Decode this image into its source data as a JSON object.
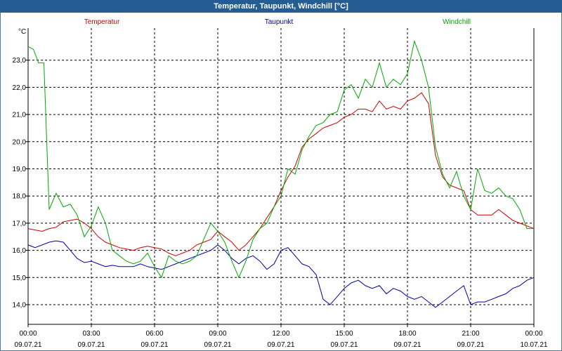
{
  "window": {
    "title": "Temperatur, Taupunkt, Windchill [°C]"
  },
  "chart_data": {
    "type": "line",
    "title": "Temperatur, Taupunkt, Windchill [°C]",
    "ylabel": "°C",
    "ylim": [
      13.4,
      24.0
    ],
    "yticks": [
      "14,0",
      "15,0",
      "16,0",
      "17,0",
      "18,0",
      "19,0",
      "20,0",
      "21,0",
      "22,0",
      "23,0"
    ],
    "ytick_values": [
      14,
      15,
      16,
      17,
      18,
      19,
      20,
      21,
      22,
      23
    ],
    "xlim": [
      0,
      24
    ],
    "xticks": [
      {
        "time": "00:00",
        "date": "09.07.21",
        "hour": 0
      },
      {
        "time": "03:00",
        "date": "09.07.21",
        "hour": 3
      },
      {
        "time": "06:00",
        "date": "09.07.21",
        "hour": 6
      },
      {
        "time": "09:00",
        "date": "09.07.21",
        "hour": 9
      },
      {
        "time": "12:00",
        "date": "09.07.21",
        "hour": 12
      },
      {
        "time": "15:00",
        "date": "09.07.21",
        "hour": 15
      },
      {
        "time": "18:00",
        "date": "09.07.21",
        "hour": 18
      },
      {
        "time": "21:00",
        "date": "09.07.21",
        "hour": 21
      },
      {
        "time": "00:00",
        "date": "10.07.21",
        "hour": 24
      }
    ],
    "grid": true,
    "legend_position": "top",
    "series": [
      {
        "name": "Temperatur",
        "color": "#cc0000",
        "points": [
          [
            0,
            16.8
          ],
          [
            0.33,
            16.75
          ],
          [
            0.67,
            16.7
          ],
          [
            1,
            16.8
          ],
          [
            1.33,
            16.85
          ],
          [
            1.67,
            17.05
          ],
          [
            2,
            17.1
          ],
          [
            2.33,
            17.15
          ],
          [
            2.67,
            17.0
          ],
          [
            3,
            16.8
          ],
          [
            3.33,
            16.5
          ],
          [
            3.67,
            16.3
          ],
          [
            4,
            16.2
          ],
          [
            4.33,
            16.1
          ],
          [
            4.67,
            16.05
          ],
          [
            5,
            16.0
          ],
          [
            5.33,
            16.1
          ],
          [
            5.67,
            16.15
          ],
          [
            6,
            16.1
          ],
          [
            6.33,
            16.05
          ],
          [
            6.67,
            15.9
          ],
          [
            7,
            15.8
          ],
          [
            7.33,
            15.9
          ],
          [
            7.67,
            16.0
          ],
          [
            8,
            16.2
          ],
          [
            8.33,
            16.3
          ],
          [
            8.67,
            16.4
          ],
          [
            9,
            16.7
          ],
          [
            9.33,
            16.5
          ],
          [
            9.67,
            16.3
          ],
          [
            10,
            16.0
          ],
          [
            10.33,
            16.2
          ],
          [
            10.67,
            16.5
          ],
          [
            11,
            16.8
          ],
          [
            11.33,
            17.2
          ],
          [
            11.67,
            17.6
          ],
          [
            12,
            18.2
          ],
          [
            12.33,
            18.7
          ],
          [
            12.67,
            19.1
          ],
          [
            13,
            19.8
          ],
          [
            13.33,
            20.1
          ],
          [
            13.67,
            20.3
          ],
          [
            14,
            20.5
          ],
          [
            14.33,
            20.6
          ],
          [
            14.67,
            20.7
          ],
          [
            15,
            20.9
          ],
          [
            15.33,
            21.0
          ],
          [
            15.67,
            21.2
          ],
          [
            16,
            21.2
          ],
          [
            16.33,
            21.1
          ],
          [
            16.67,
            21.5
          ],
          [
            17,
            21.2
          ],
          [
            17.33,
            21.3
          ],
          [
            17.67,
            21.2
          ],
          [
            18,
            21.5
          ],
          [
            18.33,
            21.6
          ],
          [
            18.67,
            21.8
          ],
          [
            19,
            21.4
          ],
          [
            19.33,
            19.5
          ],
          [
            19.67,
            18.7
          ],
          [
            20,
            18.4
          ],
          [
            20.33,
            18.3
          ],
          [
            20.67,
            18.2
          ],
          [
            21,
            17.5
          ],
          [
            21.33,
            17.3
          ],
          [
            21.67,
            17.3
          ],
          [
            22,
            17.3
          ],
          [
            22.33,
            17.5
          ],
          [
            22.67,
            17.3
          ],
          [
            23,
            17.1
          ],
          [
            23.33,
            17.0
          ],
          [
            23.67,
            16.9
          ],
          [
            24,
            16.8
          ]
        ]
      },
      {
        "name": "Taupunkt",
        "color": "#0000aa",
        "points": [
          [
            0,
            16.2
          ],
          [
            0.33,
            16.1
          ],
          [
            0.67,
            16.2
          ],
          [
            1,
            16.3
          ],
          [
            1.33,
            16.35
          ],
          [
            1.67,
            16.3
          ],
          [
            2,
            16.0
          ],
          [
            2.33,
            15.7
          ],
          [
            2.67,
            15.55
          ],
          [
            3,
            15.6
          ],
          [
            3.33,
            15.5
          ],
          [
            3.67,
            15.4
          ],
          [
            4,
            15.45
          ],
          [
            4.33,
            15.4
          ],
          [
            4.67,
            15.4
          ],
          [
            5,
            15.4
          ],
          [
            5.33,
            15.5
          ],
          [
            5.67,
            15.4
          ],
          [
            6,
            15.35
          ],
          [
            6.33,
            15.3
          ],
          [
            6.67,
            15.4
          ],
          [
            7,
            15.5
          ],
          [
            7.33,
            15.6
          ],
          [
            7.67,
            15.7
          ],
          [
            8,
            15.8
          ],
          [
            8.33,
            15.9
          ],
          [
            8.67,
            16.0
          ],
          [
            9,
            16.2
          ],
          [
            9.33,
            16.0
          ],
          [
            9.67,
            15.7
          ],
          [
            10,
            15.5
          ],
          [
            10.33,
            15.7
          ],
          [
            10.67,
            15.8
          ],
          [
            11,
            15.6
          ],
          [
            11.33,
            15.3
          ],
          [
            11.67,
            15.5
          ],
          [
            12,
            16.0
          ],
          [
            12.33,
            16.1
          ],
          [
            12.67,
            15.8
          ],
          [
            13,
            15.5
          ],
          [
            13.33,
            15.4
          ],
          [
            13.67,
            15.1
          ],
          [
            14,
            14.2
          ],
          [
            14.33,
            14.0
          ],
          [
            14.67,
            14.3
          ],
          [
            15,
            14.6
          ],
          [
            15.33,
            14.8
          ],
          [
            15.67,
            14.9
          ],
          [
            16,
            14.7
          ],
          [
            16.33,
            14.6
          ],
          [
            16.67,
            14.7
          ],
          [
            17,
            14.4
          ],
          [
            17.33,
            14.6
          ],
          [
            17.67,
            14.5
          ],
          [
            18,
            14.3
          ],
          [
            18.33,
            14.2
          ],
          [
            18.67,
            14.3
          ],
          [
            19,
            14.1
          ],
          [
            19.33,
            13.9
          ],
          [
            19.67,
            14.1
          ],
          [
            20,
            14.3
          ],
          [
            20.33,
            14.5
          ],
          [
            20.67,
            14.7
          ],
          [
            21,
            14.0
          ],
          [
            21.33,
            14.1
          ],
          [
            21.67,
            14.1
          ],
          [
            22,
            14.2
          ],
          [
            22.33,
            14.3
          ],
          [
            22.67,
            14.4
          ],
          [
            23,
            14.6
          ],
          [
            23.33,
            14.7
          ],
          [
            23.67,
            14.9
          ],
          [
            24,
            15.0
          ]
        ]
      },
      {
        "name": "Windchill",
        "color": "#00aa00",
        "points": [
          [
            0,
            23.5
          ],
          [
            0.25,
            23.4
          ],
          [
            0.5,
            22.9
          ],
          [
            0.75,
            22.9
          ],
          [
            1,
            17.5
          ],
          [
            1.33,
            18.1
          ],
          [
            1.67,
            17.6
          ],
          [
            2,
            17.7
          ],
          [
            2.33,
            17.3
          ],
          [
            2.67,
            16.5
          ],
          [
            3,
            16.9
          ],
          [
            3.33,
            17.6
          ],
          [
            3.67,
            17.0
          ],
          [
            4,
            16.0
          ],
          [
            4.33,
            15.8
          ],
          [
            4.67,
            15.6
          ],
          [
            5,
            15.5
          ],
          [
            5.33,
            15.6
          ],
          [
            5.67,
            15.9
          ],
          [
            6,
            15.4
          ],
          [
            6.33,
            15.0
          ],
          [
            6.67,
            15.8
          ],
          [
            7,
            15.6
          ],
          [
            7.33,
            15.5
          ],
          [
            7.67,
            15.6
          ],
          [
            8,
            15.8
          ],
          [
            8.33,
            16.4
          ],
          [
            8.67,
            17.0
          ],
          [
            9,
            16.7
          ],
          [
            9.33,
            16.3
          ],
          [
            9.67,
            15.6
          ],
          [
            10,
            15.0
          ],
          [
            10.33,
            15.6
          ],
          [
            10.67,
            16.4
          ],
          [
            11,
            16.8
          ],
          [
            11.33,
            17.0
          ],
          [
            11.67,
            17.6
          ],
          [
            12,
            18.0
          ],
          [
            12.33,
            19.0
          ],
          [
            12.67,
            18.8
          ],
          [
            13,
            19.7
          ],
          [
            13.33,
            20.2
          ],
          [
            13.67,
            20.6
          ],
          [
            14,
            20.7
          ],
          [
            14.33,
            21.0
          ],
          [
            14.67,
            21.1
          ],
          [
            15,
            21.9
          ],
          [
            15.33,
            22.1
          ],
          [
            15.67,
            21.6
          ],
          [
            16,
            22.3
          ],
          [
            16.33,
            22.0
          ],
          [
            16.67,
            22.9
          ],
          [
            17,
            22.0
          ],
          [
            17.33,
            22.3
          ],
          [
            17.67,
            22.1
          ],
          [
            18,
            22.5
          ],
          [
            18.33,
            23.7
          ],
          [
            18.67,
            23.0
          ],
          [
            19,
            22.0
          ],
          [
            19.33,
            19.8
          ],
          [
            19.67,
            18.8
          ],
          [
            20,
            18.3
          ],
          [
            20.33,
            18.9
          ],
          [
            20.67,
            18.0
          ],
          [
            21,
            17.5
          ],
          [
            21.33,
            19.0
          ],
          [
            21.67,
            18.2
          ],
          [
            22,
            18.1
          ],
          [
            22.33,
            18.3
          ],
          [
            22.67,
            18.0
          ],
          [
            23,
            17.9
          ],
          [
            23.33,
            17.5
          ],
          [
            23.67,
            16.8
          ],
          [
            24,
            16.8
          ]
        ]
      }
    ]
  }
}
